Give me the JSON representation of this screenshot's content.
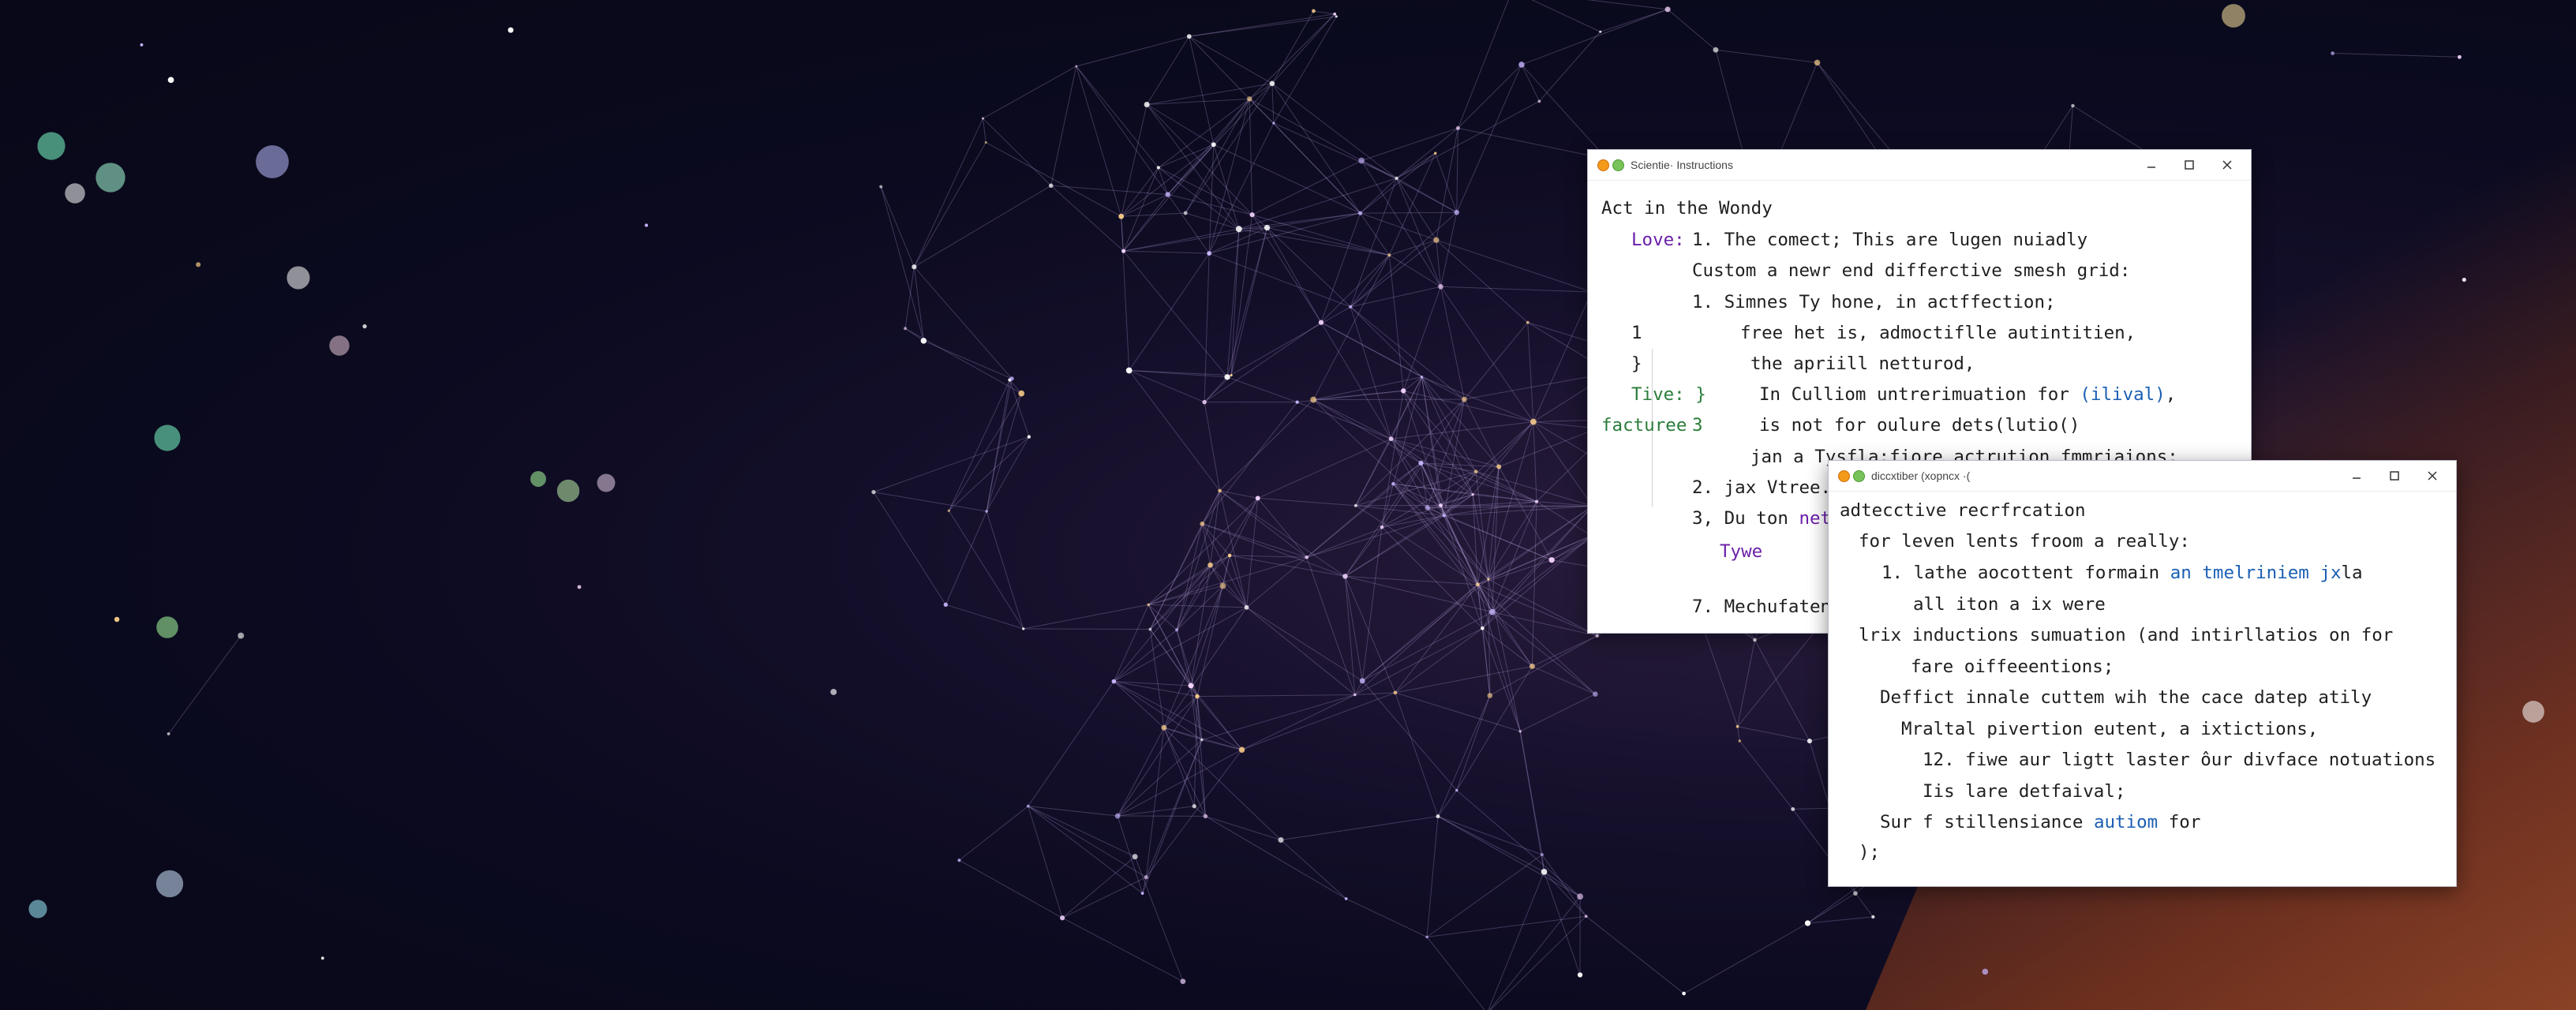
{
  "desktop": {
    "background_colors": [
      "#0b0a1f",
      "#2a1d3d",
      "#aa5028"
    ]
  },
  "window1": {
    "title": "Scientie· Instructions",
    "icons": [
      "app-icon-orange",
      "app-icon-green"
    ],
    "controls": [
      "minimize-icon",
      "maximize-icon",
      "close-icon"
    ],
    "lines": [
      {
        "prefix": "",
        "text": "Act in the Wondy"
      },
      {
        "prefix": "Love:",
        "text": "1. The comect; This are lugen nuiadly"
      },
      {
        "prefix": "",
        "text": "Custom a newr end differctive smesh grid:"
      },
      {
        "prefix": "",
        "text": "1. Simnes Ty hone, in actffection;"
      },
      {
        "prefix": "1",
        "text": "free het is, admoctiflle autintitien,"
      },
      {
        "prefix": "}",
        "text": "the apriill netturod,"
      },
      {
        "prefix": "Tive: }",
        "text_a": "In Culliom untrerimuation for ",
        "text_b": "(ilival)",
        "text_c": ","
      },
      {
        "prefix_a": "facturee",
        "prefix_b": "3",
        "text": "is not for oulure dets(lutio()"
      },
      {
        "prefix": "",
        "text": "jan a Tysfla:fiore actrution fmmriaions;"
      },
      {
        "prefix": "",
        "text": "2. jax Vtree."
      },
      {
        "prefix": "",
        "text_a": "3, Du ton ",
        "text_b": "netu"
      },
      {
        "prefix": "",
        "text": "Tywe"
      },
      {
        "prefix": "",
        "text": "7. Mechufaten"
      }
    ]
  },
  "window2": {
    "title": "diccxtiber (xopncx ·(",
    "icons": [
      "app-icon-orange",
      "app-icon-green"
    ],
    "controls": [
      "minimize-icon",
      "maximize-icon",
      "close-icon"
    ],
    "lines": [
      {
        "text": "adtecctive recrfrcation"
      },
      {
        "text": "for leven lents froom a really:"
      },
      {
        "text_a": "1. lathe aocottent formain ",
        "text_b": "an tmelriniem jx",
        "text_c": "la"
      },
      {
        "text": "all iton a ix were"
      },
      {
        "text": "lrix inductions sumuation (and intirllatios on for"
      },
      {
        "text": "fare oiffeeentions;"
      },
      {
        "text": "Deffict innale cuttem wih the cace datep atily"
      },
      {
        "text": "Mraltal pivertion eutent, a ixtictions,"
      },
      {
        "text": "12. fiwe aur ligtt laster ôur divface notuations"
      },
      {
        "text": "Iis lare detfaival;"
      },
      {
        "text_a": "Sur f stillensiance ",
        "text_b": "autiom",
        "text_c": " for"
      },
      {
        "text": ");"
      }
    ]
  },
  "colors": {
    "keyword_purple": "#6b1fa8",
    "keyword_green": "#2a7d3a",
    "link_blue": "#1b5fb4"
  }
}
